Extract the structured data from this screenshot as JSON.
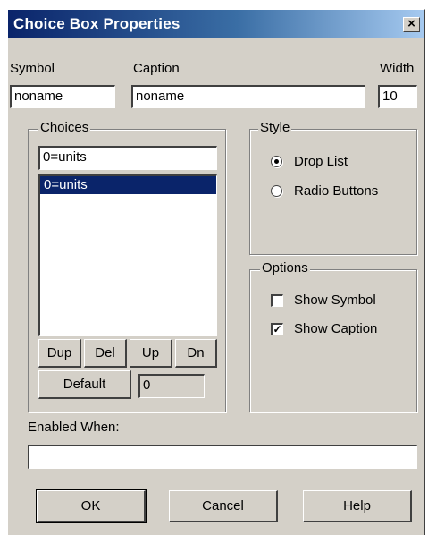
{
  "window": {
    "title": "Choice Box Properties",
    "close_glyph": "×"
  },
  "fields": {
    "symbol_label": "Symbol",
    "symbol_value": "noname",
    "caption_label": "Caption",
    "caption_value": "noname",
    "width_label": "Width",
    "width_value": "10"
  },
  "choices": {
    "title": "Choices",
    "edit_value": "0=units",
    "items": [
      "0=units"
    ],
    "selected_index": 0,
    "buttons": {
      "dup": "Dup",
      "del": "Del",
      "up": "Up",
      "dn": "Dn"
    },
    "default_label": "Default",
    "default_value": "0"
  },
  "style": {
    "title": "Style",
    "options": [
      "Drop List",
      "Radio Buttons"
    ],
    "selected": "Drop List"
  },
  "options": {
    "title": "Options",
    "show_symbol_label": "Show Symbol",
    "show_symbol_checked": false,
    "show_caption_label": "Show Caption",
    "show_caption_checked": true,
    "check_glyph": "✓"
  },
  "enabled_when": {
    "label": "Enabled When:",
    "value": ""
  },
  "footer": {
    "ok": "OK",
    "cancel": "Cancel",
    "help": "Help"
  },
  "colors": {
    "dialog_bg": "#d4d0c8",
    "titlebar_start": "#0a246a",
    "titlebar_end": "#a6caf0",
    "selection": "#0a246a"
  }
}
